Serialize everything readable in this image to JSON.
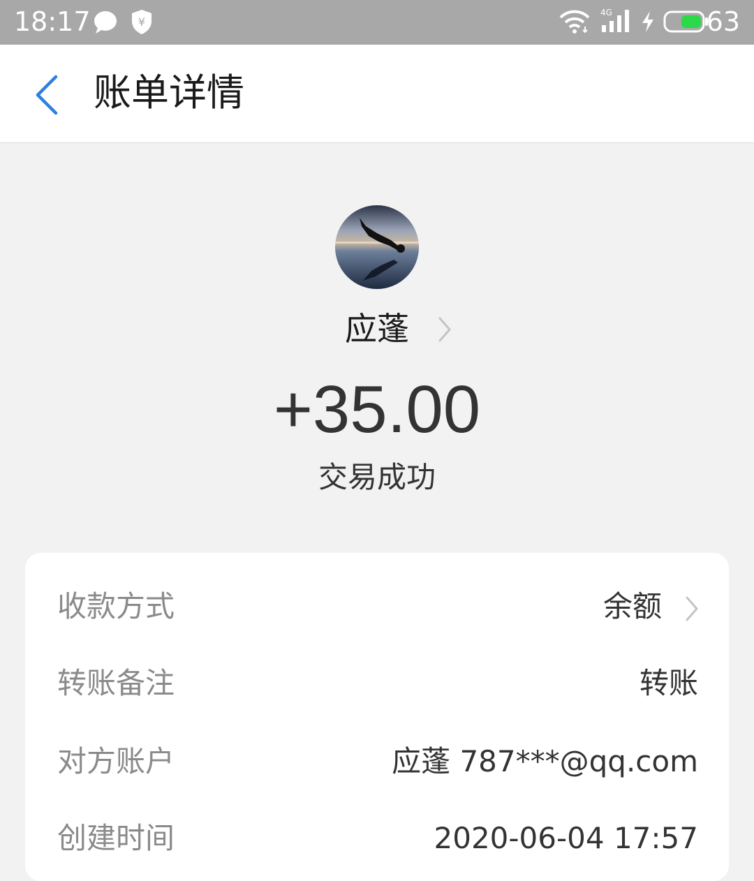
{
  "status_bar": {
    "time": "18:17",
    "network": "4G",
    "battery": "63",
    "battery_color": "#2bd94a"
  },
  "nav": {
    "title": "账单详情",
    "accent": "#2f7fe0"
  },
  "transaction": {
    "payer_name": "应蓬",
    "amount": "+35.00",
    "status": "交易成功"
  },
  "details": [
    {
      "label": "收款方式",
      "value": "余额",
      "has_chevron": true
    },
    {
      "label": "转账备注",
      "value": "转账",
      "has_chevron": false
    },
    {
      "label": "对方账户",
      "value": "应蓬 787***@qq.com",
      "has_chevron": false
    },
    {
      "label": "创建时间",
      "value": "2020-06-04 17:57",
      "has_chevron": false
    }
  ],
  "icons": [
    "message-icon",
    "shield-icon",
    "wifi-icon",
    "signal-icon",
    "charging-icon",
    "battery-icon",
    "back-arrow-icon",
    "chevron-right-icon"
  ]
}
